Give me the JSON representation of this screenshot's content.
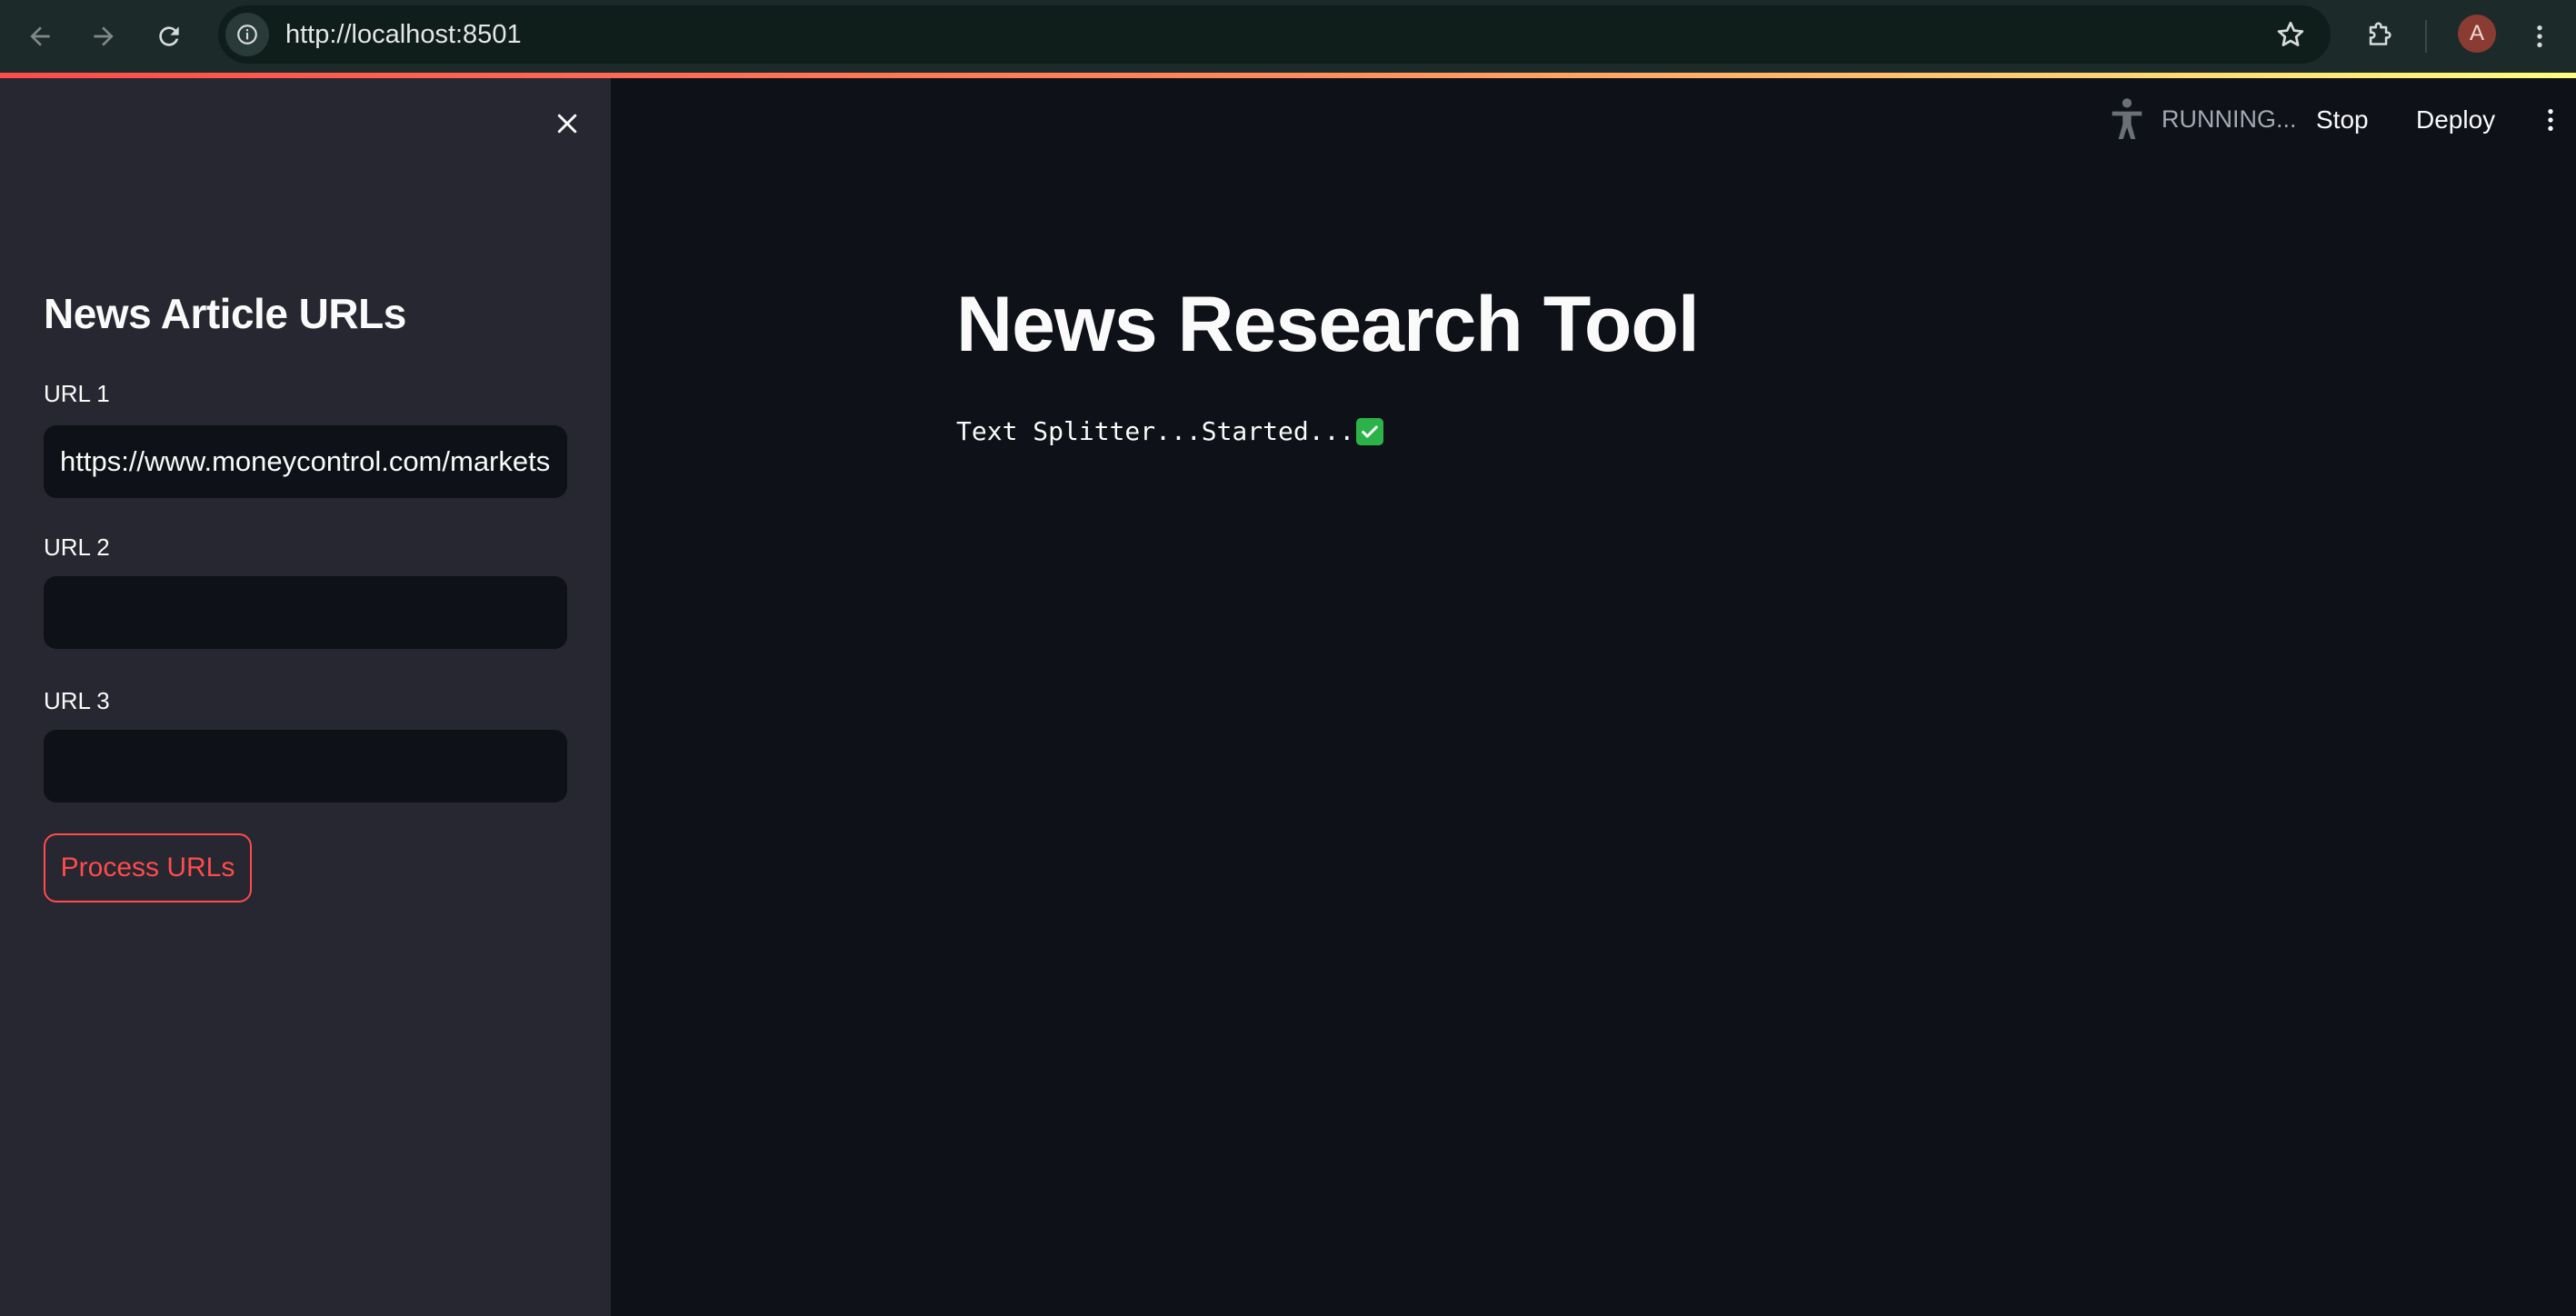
{
  "browser": {
    "url": "http://localhost:8501",
    "profile_initial": "A"
  },
  "sidebar": {
    "title": "News Article URLs",
    "fields": [
      {
        "label": "URL 1",
        "value": "https://www.moneycontrol.com/markets"
      },
      {
        "label": "URL 2",
        "value": ""
      },
      {
        "label": "URL 3",
        "value": ""
      }
    ],
    "process_button_label": "Process URLs"
  },
  "header": {
    "status": "RUNNING...",
    "stop_label": "Stop",
    "deploy_label": "Deploy"
  },
  "main": {
    "title": "News Research Tool",
    "status_message": "Text Splitter...Started..."
  },
  "colors": {
    "accent": "#ff4b4b",
    "background": "#0e1117",
    "sidebar_background": "#262730",
    "check_green": "#2bb34a"
  },
  "icons": {
    "back": "arrow-left-icon",
    "forward": "arrow-right-icon",
    "reload": "reload-icon",
    "site_info": "info-icon",
    "bookmark": "star-icon",
    "extensions": "puzzle-icon",
    "browser_menu": "kebab-icon",
    "sidebar_close": "close-icon",
    "running_status": "person-icon",
    "app_menu": "kebab-icon",
    "status_check": "check-icon"
  }
}
